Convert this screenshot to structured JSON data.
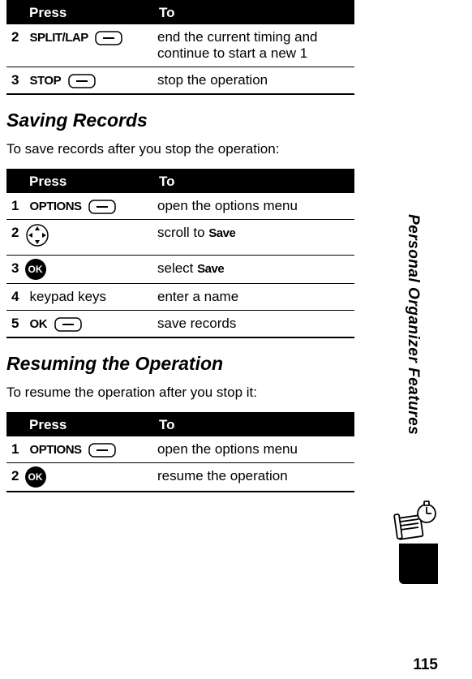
{
  "page_number": "115",
  "side_label": "Personal Organizer Features",
  "table1": {
    "head_press": "Press",
    "head_to": "To",
    "rows": [
      {
        "num": "2",
        "key": "SPLIT/LAP",
        "icon": "softkey",
        "desc": "end the current timing and continue to start a new 1"
      },
      {
        "num": "3",
        "key": "STOP",
        "icon": "softkey",
        "desc": "stop the operation"
      }
    ]
  },
  "heading1": "Saving Records",
  "intro1": "To save records after you stop the operation:",
  "table2": {
    "head_press": "Press",
    "head_to": "To",
    "rows": [
      {
        "num": "1",
        "key": "OPTIONS",
        "icon": "softkey",
        "desc": "open the options menu"
      },
      {
        "num": "2",
        "key": "",
        "icon": "nav",
        "desc_pre": "scroll to ",
        "desc_bold": "Save"
      },
      {
        "num": "3",
        "key": "",
        "icon": "ok",
        "desc_pre": "select ",
        "desc_bold": "Save"
      },
      {
        "num": "4",
        "key": "keypad keys",
        "icon": "",
        "desc": "enter a name"
      },
      {
        "num": "5",
        "key": "OK",
        "icon": "softkey",
        "desc": "save records"
      }
    ]
  },
  "heading2": "Resuming the Operation",
  "intro2": "To resume the operation after you stop it:",
  "table3": {
    "head_press": "Press",
    "head_to": "To",
    "rows": [
      {
        "num": "1",
        "key": "OPTIONS",
        "icon": "softkey",
        "desc": "open the options menu"
      },
      {
        "num": "2",
        "key": "",
        "icon": "ok",
        "desc": "resume the operation"
      }
    ]
  },
  "ok_label": "OK"
}
